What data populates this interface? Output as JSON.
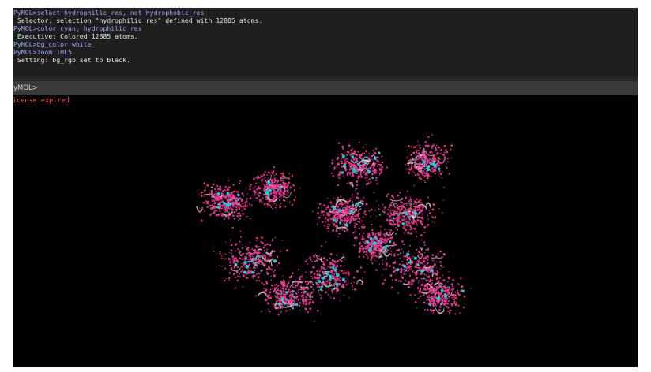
{
  "console": {
    "lines": [
      {
        "text": "PyMOL>select hydrophilic_res, not hydrophobic_res",
        "kind": "cmd"
      },
      {
        "text": " Selector: selection \"hydrophilic_res\" defined with 12885 atoms.",
        "kind": "out"
      },
      {
        "text": "PyMOL>color cyan, hydrophilic_res",
        "kind": "cmd"
      },
      {
        "text": " Executive: Colored 12885 atoms.",
        "kind": "out"
      },
      {
        "text": "PyMOL>bg_color white",
        "kind": "cmd"
      },
      {
        "text": "PyMOL>zoom 1HL5",
        "kind": "cmd"
      },
      {
        "text": " Setting: bg_rgb set to black.",
        "kind": "out"
      }
    ],
    "prompt": "yMOL>",
    "input_value": ""
  },
  "viewport": {
    "license_text": "icense expired",
    "background": "#000000",
    "structure_colors": {
      "dots": "#e6338c",
      "highlight": "#1ec8dc",
      "backbone": "#d2d2d2"
    }
  },
  "colors": {
    "log_background": "#1e1e1e",
    "command_text": "#9ea8ff",
    "output_text": "#e8e8e8",
    "license_text": "#ff5a5a"
  }
}
